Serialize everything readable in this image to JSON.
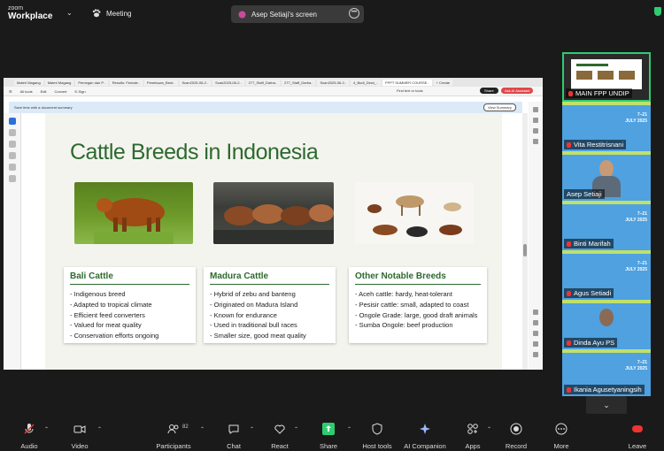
{
  "app": {
    "logo_top": "zoom",
    "logo_bottom": "Workplace",
    "meeting_label": "Meeting"
  },
  "share": {
    "label": "Asep Setiaji's screen"
  },
  "browser": {
    "tabs": [
      "Materi Magang",
      "Materi Magang",
      "Pemegan dan P..",
      "Results: Female..",
      "Penelusan_Bent..",
      "Scan2025-06-2..",
      "Scan2025-06-2..",
      "277_Staff_Darba..",
      "277_Staff_Darba..",
      "Scan2025-06-2..",
      "4_Budi_Dewi_..",
      "FPPT SUMMER COURSE..",
      "+ Create"
    ],
    "ribbon": [
      "All tools",
      "Edit",
      "Convert",
      "E-Sign"
    ],
    "find_label": "Find text or tools",
    "share_label": "Share",
    "ai_label": "Ask AI Assistant",
    "notice": "Save time with a document summary",
    "notice_btn": "View Summary"
  },
  "slide": {
    "title": "Cattle Breeds in Indonesia",
    "cards": [
      {
        "heading": "Bali Cattle",
        "items": [
          "Indigenous breed",
          "Adapted to tropical climate",
          "Efficient feed converters",
          "Valued for meat quality",
          "Conservation efforts ongoing"
        ]
      },
      {
        "heading": "Madura Cattle",
        "items": [
          "Hybrid of zebu and banteng",
          "Originated on Madura Island",
          "Known for endurance",
          "Used in traditional bull races",
          "Smaller size, good meat quality"
        ]
      },
      {
        "heading": "Other Notable Breeds",
        "items": [
          "Aceh cattle: hardy, heat-tolerant",
          "Pesisir cattle: small, adapted to coast",
          "Ongole Grade: large, good draft animals",
          "Sumba Ongole: beef production"
        ]
      }
    ]
  },
  "participants": [
    {
      "name": "MAIN FPP UNDIP"
    },
    {
      "name": "Vita Restitrisnani"
    },
    {
      "name": "Asep Setiaji"
    },
    {
      "name": "Binti Marifah"
    },
    {
      "name": "Agus Setiadi"
    },
    {
      "name": "Dinda Ayu PS"
    },
    {
      "name": "Ikania Agusetyaningsih"
    }
  ],
  "tile_badge": {
    "l1": "7–21",
    "l2": "JULY 2025"
  },
  "toolbar": {
    "audio": "Audio",
    "video": "Video",
    "participants": "Participants",
    "participants_count": "82",
    "chat": "Chat",
    "react": "React",
    "share": "Share",
    "host_tools": "Host tools",
    "ai_companion": "AI Companion",
    "apps": "Apps",
    "record": "Record",
    "more": "More",
    "leave": "Leave"
  },
  "colors": {
    "brand_green": "#2d6a2f",
    "tile_blue": "#4fa1e0",
    "share_green": "#2ecc71",
    "leave_red": "#e33"
  }
}
